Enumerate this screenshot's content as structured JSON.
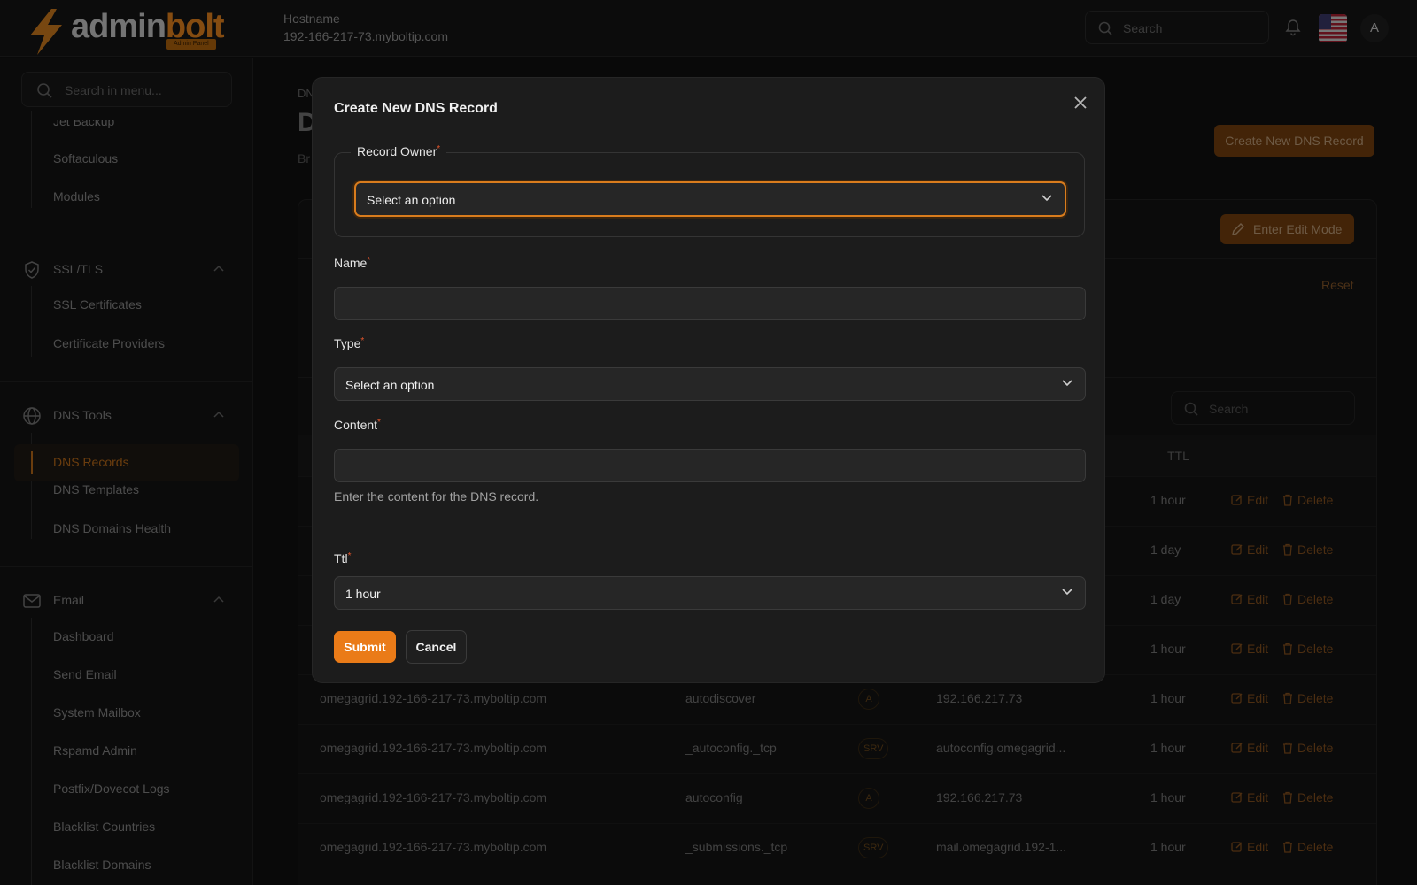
{
  "brand": {
    "name_part1": "admin",
    "name_part2": "bolt",
    "badge": "Admin Panel"
  },
  "header": {
    "hostname_label": "Hostname",
    "hostname_value": "192-166-217-73.myboltip.com",
    "search_placeholder": "Search",
    "avatar_initial": "A"
  },
  "sidebar": {
    "search_placeholder": "Search in menu...",
    "items_top": [
      "Jet Backup",
      "Softaculous",
      "Modules"
    ],
    "group_ssl": {
      "label": "SSL/TLS",
      "items": [
        "SSL Certificates",
        "Certificate Providers"
      ]
    },
    "group_dns": {
      "label": "DNS Tools",
      "items": [
        "DNS Records",
        "DNS Templates",
        "DNS Domains Health"
      ],
      "active": "DNS Records"
    },
    "group_email": {
      "label": "Email",
      "items": [
        "Dashboard",
        "Send Email",
        "System Mailbox",
        "Rspamd Admin",
        "Postfix/Dovecot Logs",
        "Blacklist Countries",
        "Blacklist Domains"
      ]
    }
  },
  "page": {
    "breadcrumb": "DN",
    "title": "D",
    "subtitle": "Br",
    "create_button": "Create New DNS Record",
    "edit_mode_button": "Enter Edit Mode",
    "reset_link": "Reset",
    "table_search_placeholder": "Search",
    "ttl_header": "TTL",
    "edit_label": "Edit",
    "delete_label": "Delete",
    "rows_partial": [
      {
        "ttl": "1 hour"
      },
      {
        "ttl": "1 day"
      },
      {
        "ttl": "1 day"
      },
      {
        "ttl": "1 hour"
      }
    ],
    "rows": [
      {
        "domain": "omegagrid.192-166-217-73.myboltip.com",
        "name": "autodiscover",
        "type": "A",
        "content": "192.166.217.73",
        "ttl": "1 hour"
      },
      {
        "domain": "omegagrid.192-166-217-73.myboltip.com",
        "name": "_autoconfig._tcp",
        "type": "SRV",
        "content": "autoconfig.omegagrid...",
        "ttl": "1 hour"
      },
      {
        "domain": "omegagrid.192-166-217-73.myboltip.com",
        "name": "autoconfig",
        "type": "A",
        "content": "192.166.217.73",
        "ttl": "1 hour"
      },
      {
        "domain": "omegagrid.192-166-217-73.myboltip.com",
        "name": "_submissions._tcp",
        "type": "SRV",
        "content": "mail.omegagrid.192-1...",
        "ttl": "1 hour"
      }
    ]
  },
  "modal": {
    "title": "Create New DNS Record",
    "record_owner_label": "Record Owner",
    "record_owner_value": "Select an option",
    "name_label": "Name",
    "name_value": "",
    "type_label": "Type",
    "type_value": "Select an option",
    "content_label": "Content",
    "content_value": "",
    "content_help": "Enter the content for the DNS record.",
    "ttl_label": "Ttl",
    "ttl_value": "1 hour",
    "required_mark": "*",
    "submit_label": "Submit",
    "cancel_label": "Cancel"
  },
  "colors": {
    "accent": "#ea7b18",
    "background": "#121212",
    "modal": "#1c1c1c",
    "required": "#e2552c"
  }
}
